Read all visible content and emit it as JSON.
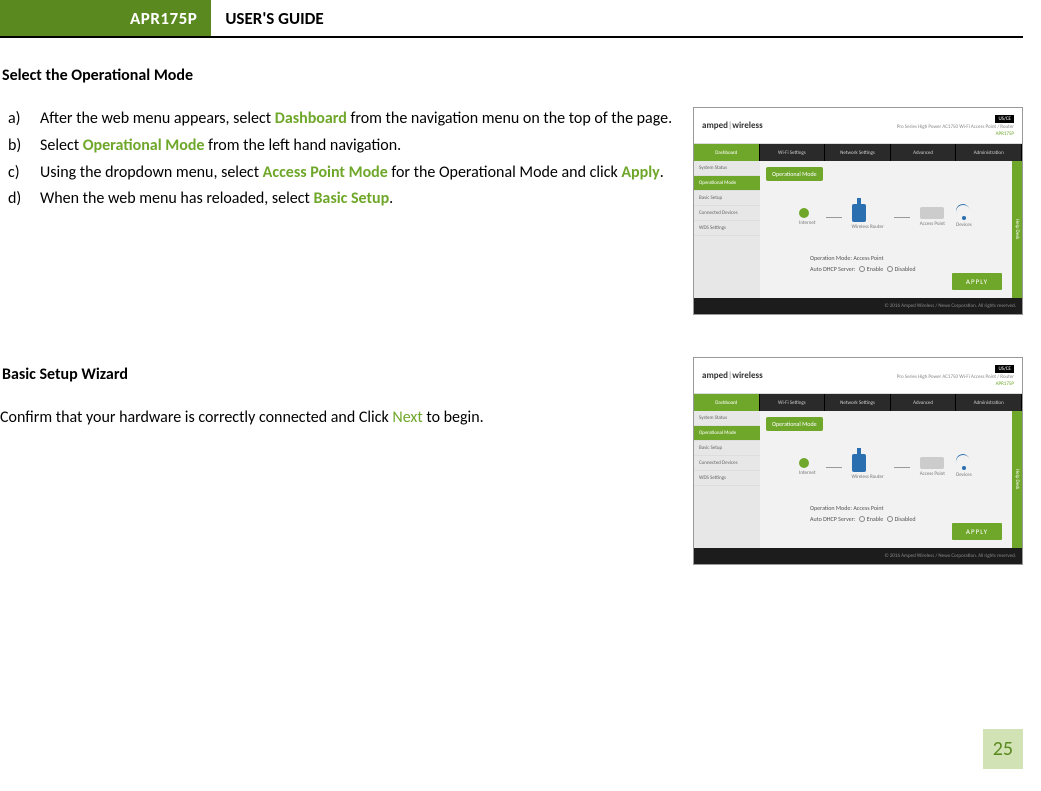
{
  "header": {
    "badge": "APR175P",
    "title": "USER'S GUIDE"
  },
  "section1": {
    "heading": "Select the Operational Mode",
    "items": [
      {
        "marker": "a)",
        "pre": "After the web menu appears, select ",
        "hl": "Dashboard",
        "post": " from the navigation menu on the top of the page."
      },
      {
        "marker": "b)",
        "pre": "Select ",
        "hl": "Operational Mode",
        "post": " from the left hand navigation."
      },
      {
        "marker": "c)",
        "pre": "Using the dropdown menu, select ",
        "hl": "Access Point Mode",
        "mid": " for the Operational Mode and click ",
        "hl2": "Apply",
        "post": "."
      },
      {
        "marker": "d)",
        "pre": "When the web menu has reloaded, select ",
        "hl": "Basic Setup",
        "post": "."
      }
    ]
  },
  "section2": {
    "heading": "Basic Setup Wizard",
    "para_pre": "Confirm that your hardware is correctly connected and Click ",
    "para_hl": "Next",
    "para_post": " to begin."
  },
  "fig": {
    "logo": "amped",
    "logo2": "wireless",
    "subtitle": "Pro Series High Power AC1750 Wi-Fi Access Point / Router",
    "model": "APR175P",
    "usflag": "US/CE",
    "tabs": [
      "Dashboard",
      "Wi-Fi Settings",
      "Network Settings",
      "Advanced",
      "Administration"
    ],
    "side": [
      "System Status",
      "Operational Mode",
      "Basic Setup",
      "Connected Devices",
      "WDS Settings"
    ],
    "banner": "Operational Mode",
    "diag_labels": [
      "Internet",
      "Wireless Router",
      "Access Point",
      "Devices"
    ],
    "ctrl_mode_label": "Operation Mode:",
    "ctrl_mode_value": "Access Point",
    "ctrl_dhcp_label": "Auto DHCP Server:",
    "ctrl_dhcp_opt1": "Enable",
    "ctrl_dhcp_opt2": "Disabled",
    "apply": "APPLY",
    "footer": "© 2016 Amped Wireless / Newo Corporation. All rights reserved.",
    "helpdesk": "Help Desk"
  },
  "page_number": "25"
}
